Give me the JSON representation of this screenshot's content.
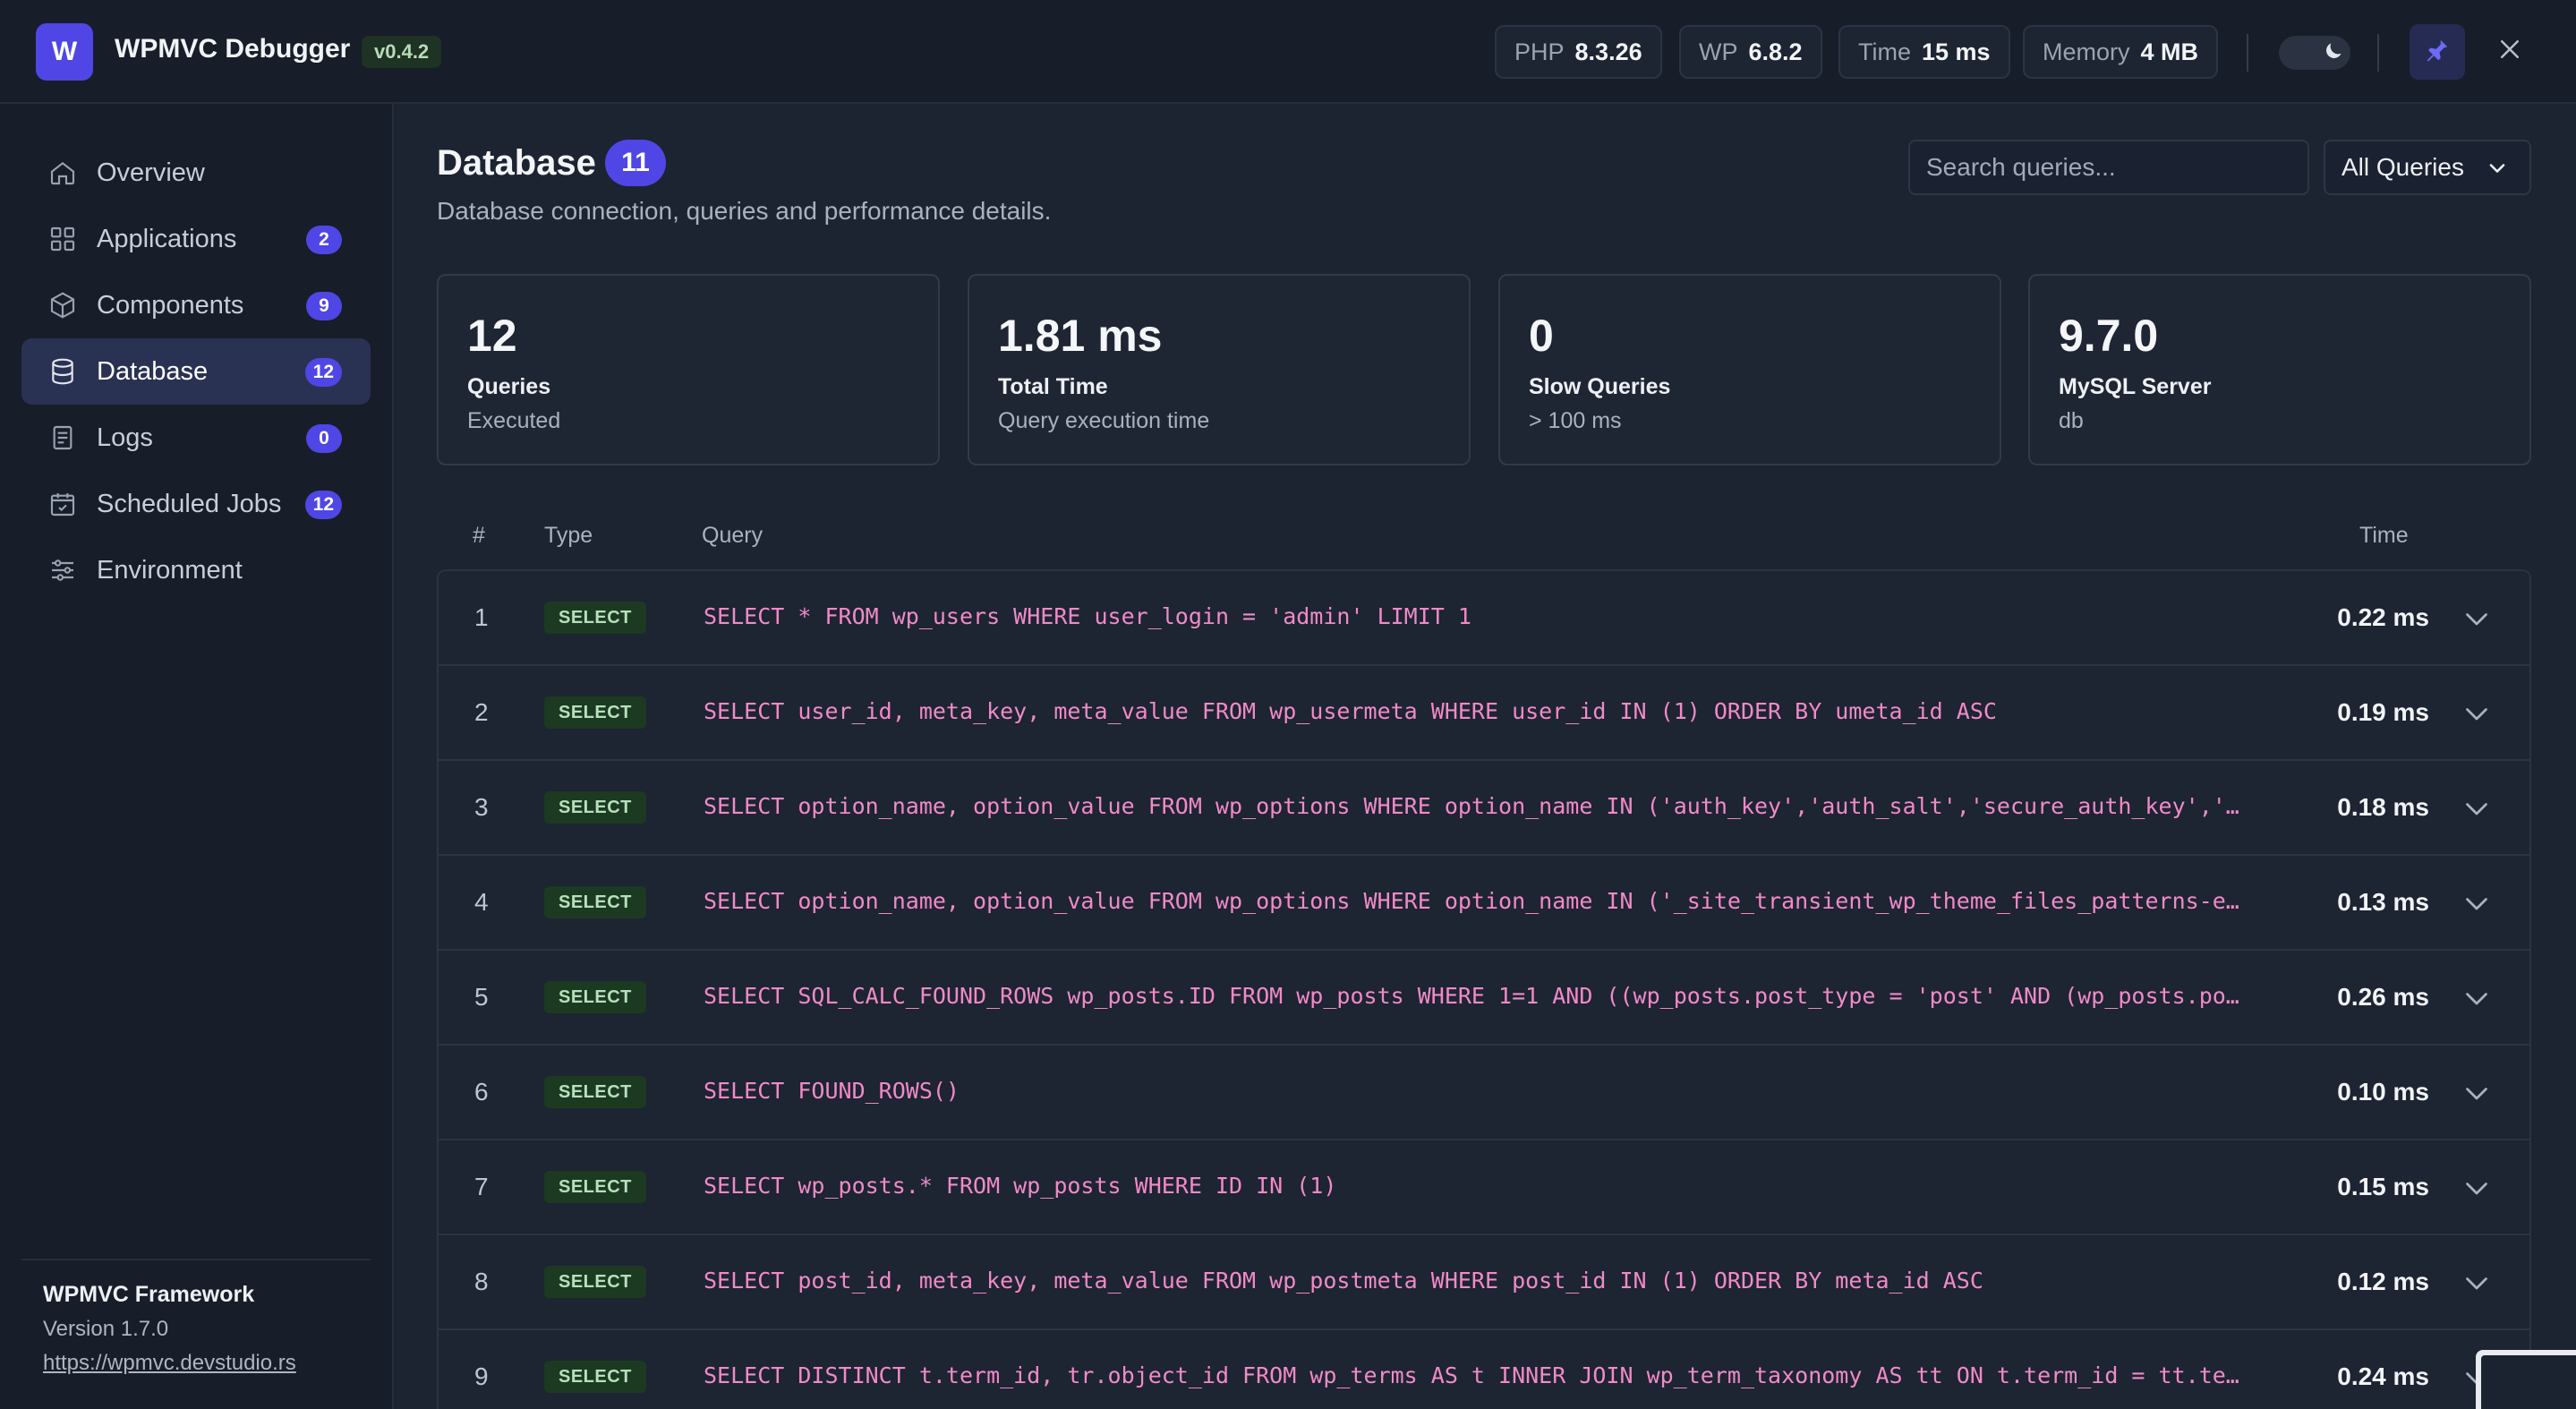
{
  "header": {
    "logo_letter": "W",
    "title": "WPMVC Debugger",
    "version": "v0.4.2",
    "metrics": [
      {
        "key": "PHP",
        "value": "8.3.26"
      },
      {
        "key": "WP",
        "value": "6.8.2"
      },
      {
        "key": "Time",
        "value": "15 ms"
      },
      {
        "key": "Memory",
        "value": "4 MB"
      }
    ],
    "theme": "dark",
    "accent_color": "#4f46e5"
  },
  "sidebar": {
    "items": [
      {
        "label": "Overview",
        "icon": "home-icon",
        "badge": null
      },
      {
        "label": "Applications",
        "icon": "grid-icon",
        "badge": "2"
      },
      {
        "label": "Components",
        "icon": "cube-icon",
        "badge": "9"
      },
      {
        "label": "Database",
        "icon": "database-icon",
        "badge": "12",
        "active": true
      },
      {
        "label": "Logs",
        "icon": "document-icon",
        "badge": "0"
      },
      {
        "label": "Scheduled Jobs",
        "icon": "calendar-icon",
        "badge": "12"
      },
      {
        "label": "Environment",
        "icon": "sliders-icon",
        "badge": null
      }
    ],
    "footer": {
      "name": "WPMVC Framework",
      "version": "Version 1.7.0",
      "link": "https://wpmvc.devstudio.rs"
    }
  },
  "main": {
    "title": "Database",
    "title_badge": "11",
    "subtitle": "Database connection, queries and performance details.",
    "search": {
      "placeholder": "Search queries..."
    },
    "filter": {
      "selected": "All Queries"
    },
    "stats": [
      {
        "value": "12",
        "label": "Queries",
        "desc": "Executed"
      },
      {
        "value": "1.81 ms",
        "label": "Total Time",
        "desc": "Query execution time"
      },
      {
        "value": "0",
        "label": "Slow Queries",
        "desc": "> 100 ms"
      },
      {
        "value": "9.7.0",
        "label": "MySQL Server",
        "desc": "db"
      }
    ],
    "table": {
      "headers": {
        "num": "#",
        "type": "Type",
        "query": "Query",
        "time": "Time"
      },
      "rows": [
        {
          "num": "1",
          "type": "SELECT",
          "query": "SELECT * FROM wp_users WHERE user_login = 'admin' LIMIT 1",
          "time": "0.22 ms"
        },
        {
          "num": "2",
          "type": "SELECT",
          "query": "SELECT user_id, meta_key, meta_value FROM wp_usermeta WHERE user_id IN (1) ORDER BY umeta_id ASC",
          "time": "0.19 ms"
        },
        {
          "num": "3",
          "type": "SELECT",
          "query": "SELECT option_name, option_value FROM wp_options WHERE option_name IN ('auth_key','auth_salt','secure_auth_key','s...",
          "time": "0.18 ms"
        },
        {
          "num": "4",
          "type": "SELECT",
          "query": "SELECT option_name, option_value FROM wp_options WHERE option_name IN ('_site_transient_wp_theme_files_patterns-e4...",
          "time": "0.13 ms"
        },
        {
          "num": "5",
          "type": "SELECT",
          "query": "SELECT SQL_CALC_FOUND_ROWS wp_posts.ID FROM wp_posts WHERE 1=1 AND ((wp_posts.post_type = 'post' AND (wp_posts.pos...",
          "time": "0.26 ms"
        },
        {
          "num": "6",
          "type": "SELECT",
          "query": "SELECT FOUND_ROWS()",
          "time": "0.10 ms"
        },
        {
          "num": "7",
          "type": "SELECT",
          "query": "SELECT wp_posts.* FROM wp_posts WHERE ID IN (1)",
          "time": "0.15 ms"
        },
        {
          "num": "8",
          "type": "SELECT",
          "query": "SELECT post_id, meta_key, meta_value FROM wp_postmeta WHERE post_id IN (1) ORDER BY meta_id ASC",
          "time": "0.12 ms"
        },
        {
          "num": "9",
          "type": "SELECT",
          "query": "SELECT DISTINCT t.term_id, tr.object_id FROM wp_terms AS t INNER JOIN wp_term_taxonomy AS tt ON t.term_id = tt.ter...",
          "time": "0.24 ms"
        }
      ]
    }
  }
}
